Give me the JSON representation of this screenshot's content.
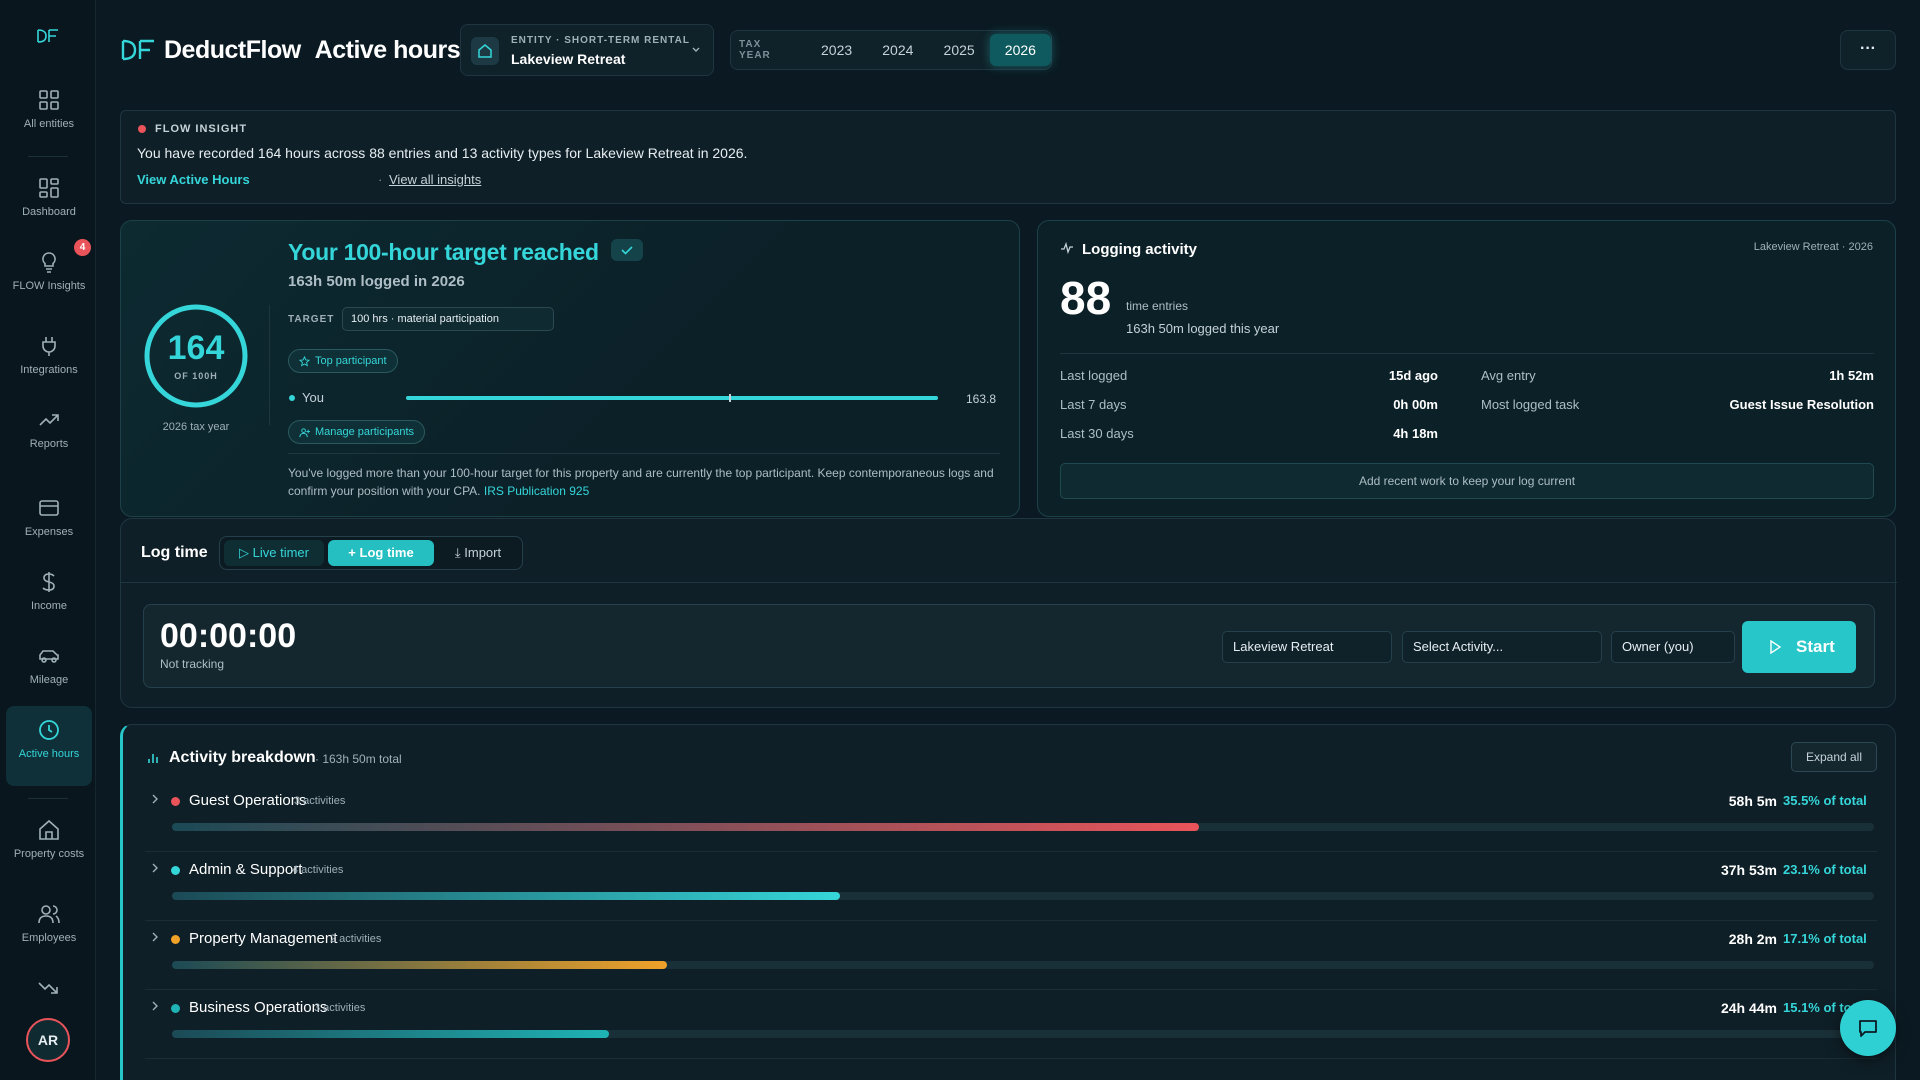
{
  "app": {
    "brand": "DeductFlow",
    "page_title": "Active hours"
  },
  "sidebar": {
    "items": [
      {
        "label": "All entities",
        "icon": "grid-icon"
      },
      {
        "label": "Dashboard",
        "icon": "dashboard-icon"
      },
      {
        "label": "FLOW Insights",
        "icon": "lightbulb-icon",
        "badge": "4"
      },
      {
        "label": "Integrations",
        "icon": "plug-icon"
      },
      {
        "label": "Reports",
        "icon": "trend-up-icon"
      },
      {
        "label": "Expenses",
        "icon": "card-icon"
      },
      {
        "label": "Income",
        "icon": "dollar-icon"
      },
      {
        "label": "Mileage",
        "icon": "car-icon"
      },
      {
        "label": "Active hours",
        "icon": "clock-icon",
        "active": true
      },
      {
        "label": "Property costs",
        "icon": "home-icon"
      },
      {
        "label": "Employees",
        "icon": "users-icon"
      }
    ],
    "avatar_initials": "AR"
  },
  "entity": {
    "label": "ENTITY · SHORT-TERM RENTAL",
    "value": "Lakeview Retreat"
  },
  "tax_year": {
    "label": "TAX YEAR",
    "years": [
      "2023",
      "2024",
      "2025",
      "2026"
    ],
    "selected": "2026"
  },
  "more_button": "···",
  "insight": {
    "label": "FLOW INSIGHT",
    "text": "You have recorded 164 hours across 88 entries and 13 activity types for Lakeview Retreat in 2026.",
    "link_primary": "View Active Hours",
    "separator": "·",
    "link_secondary": "View all insights"
  },
  "target": {
    "ring_value": "164",
    "ring_of": "OF 100H",
    "ring_caption": "2026 tax year",
    "progress_fraction": 1.0,
    "title": "Your 100-hour target reached",
    "subtitle": "163h 50m logged in 2026",
    "target_label": "TARGET",
    "target_value": "100 hrs · material participation",
    "top_badge": "Top participant",
    "participant_name": "You",
    "participant_value": "163.8",
    "participant_fill_fraction": 1.0,
    "manage_button": "Manage participants",
    "note": "You've logged more than your 100-hour target for this property and are currently the top participant. Keep contemporaneous logs and confirm your position with your CPA.",
    "note_link": "IRS Publication 925"
  },
  "logging": {
    "title": "Logging activity",
    "tag": "Lakeview Retreat · 2026",
    "entries": "88",
    "entries_unit": "time entries",
    "logged_year": "163h 50m logged this year",
    "stats_left": [
      {
        "label": "Last logged",
        "value": "15d ago"
      },
      {
        "label": "Last 7 days",
        "value": "0h 00m"
      },
      {
        "label": "Last 30 days",
        "value": "4h 18m"
      }
    ],
    "stats_right": [
      {
        "label": "Avg entry",
        "value": "1h 52m"
      },
      {
        "label": "Most logged task",
        "value": "Guest Issue Resolution"
      }
    ],
    "cta": "Add recent work to keep your log current"
  },
  "log_time": {
    "title": "Log time",
    "tabs": [
      "Live timer",
      "Log time",
      "Import"
    ],
    "active_tab": "Log time",
    "timer": "00:00:00",
    "status": "Not tracking",
    "property": "Lakeview Retreat",
    "activity_placeholder": "Select Activity...",
    "owner": "Owner (you)",
    "start": "Start"
  },
  "breakdown": {
    "title": "Activity breakdown",
    "total": "· 163h 50m total",
    "expand": "Expand all",
    "categories": [
      {
        "name": "Guest Operations",
        "count": "3 activities",
        "hours": "58h 5m",
        "pct": "35.5% of total",
        "share": 0.355,
        "color": "#e9545a"
      },
      {
        "name": "Admin & Support",
        "count": "4 activities",
        "hours": "37h 53m",
        "pct": "23.1% of total",
        "share": 0.231,
        "color": "#35d6d9"
      },
      {
        "name": "Property Management",
        "count": "2 activities",
        "hours": "28h 2m",
        "pct": "17.1% of total",
        "share": 0.171,
        "color": "#f0a229"
      },
      {
        "name": "Business Operations",
        "count": "3 activities",
        "hours": "24h 44m",
        "pct": "15.1% of total",
        "share": 0.151,
        "color": "#1fb3b5"
      }
    ]
  }
}
